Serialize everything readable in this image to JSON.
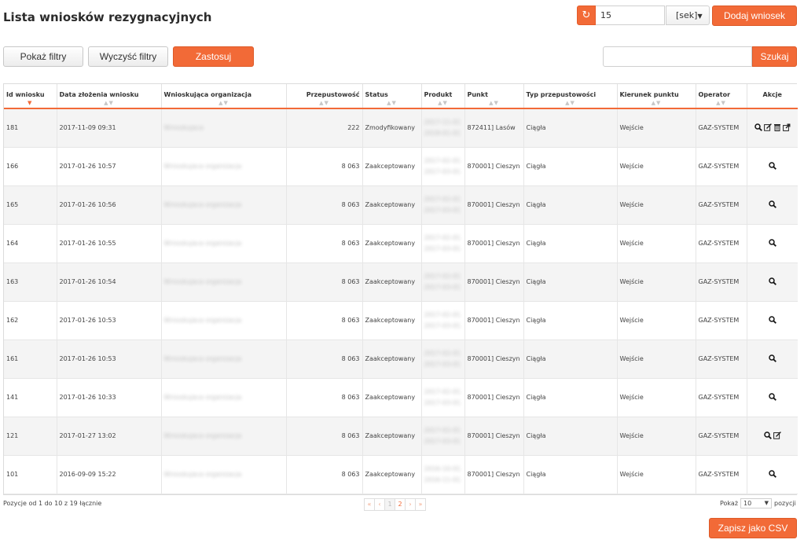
{
  "page": {
    "title": "Lista wniosków rezygnacyjnych"
  },
  "toolbar": {
    "refresh_interval": "15",
    "interval_unit": "[sek]",
    "add_label": "Dodaj wniosek"
  },
  "filters": {
    "show_label": "Pokaż filtry",
    "clear_label": "Wyczyść filtry",
    "apply_label": "Zastosuj",
    "search_value": "",
    "search_label": "Szukaj"
  },
  "table": {
    "columns": [
      "Id wniosku",
      "Data złożenia wniosku",
      "Wnioskująca organizacja",
      "Przepustowość",
      "Status",
      "Produkt",
      "Punkt",
      "Typ przepustowości",
      "Kierunek punktu",
      "Operator",
      "Akcje"
    ],
    "sorted_column": "Id wniosku",
    "sort_direction": "desc",
    "rows": [
      {
        "id": "181",
        "date": "2017-11-09 09:31",
        "org": "Wnioskujaca",
        "capacity": "222",
        "status": "Zmodyfikowany",
        "product_1": "2017-11-01",
        "product_2": "2018-01-01",
        "point": "872411] Lasów",
        "type": "Ciągła",
        "direction": "Wejście",
        "operator": "GAZ-SYSTEM",
        "actions": [
          "search-icon",
          "edit-icon",
          "trash-icon",
          "export-icon"
        ]
      },
      {
        "id": "166",
        "date": "2017-01-26 10:57",
        "org": "Wnioskujaca organizacja",
        "capacity": "8 063",
        "status": "Zaakceptowany",
        "product_1": "2017-02-01",
        "product_2": "2017-03-01",
        "point": "870001] Cieszyn",
        "type": "Ciągła",
        "direction": "Wejście",
        "operator": "GAZ-SYSTEM",
        "actions": [
          "search-icon"
        ]
      },
      {
        "id": "165",
        "date": "2017-01-26 10:56",
        "org": "Wnioskujaca organizacja",
        "capacity": "8 063",
        "status": "Zaakceptowany",
        "product_1": "2017-02-01",
        "product_2": "2017-03-01",
        "point": "870001] Cieszyn",
        "type": "Ciągła",
        "direction": "Wejście",
        "operator": "GAZ-SYSTEM",
        "actions": [
          "search-icon"
        ]
      },
      {
        "id": "164",
        "date": "2017-01-26 10:55",
        "org": "Wnioskujaca organizacja",
        "capacity": "8 063",
        "status": "Zaakceptowany",
        "product_1": "2017-02-01",
        "product_2": "2017-03-01",
        "point": "870001] Cieszyn",
        "type": "Ciągła",
        "direction": "Wejście",
        "operator": "GAZ-SYSTEM",
        "actions": [
          "search-icon"
        ]
      },
      {
        "id": "163",
        "date": "2017-01-26 10:54",
        "org": "Wnioskujaca organizacja",
        "capacity": "8 063",
        "status": "Zaakceptowany",
        "product_1": "2017-02-01",
        "product_2": "2017-03-01",
        "point": "870001] Cieszyn",
        "type": "Ciągła",
        "direction": "Wejście",
        "operator": "GAZ-SYSTEM",
        "actions": [
          "search-icon"
        ]
      },
      {
        "id": "162",
        "date": "2017-01-26 10:53",
        "org": "Wnioskujaca organizacja",
        "capacity": "8 063",
        "status": "Zaakceptowany",
        "product_1": "2017-02-01",
        "product_2": "2017-03-01",
        "point": "870001] Cieszyn",
        "type": "Ciągła",
        "direction": "Wejście",
        "operator": "GAZ-SYSTEM",
        "actions": [
          "search-icon"
        ]
      },
      {
        "id": "161",
        "date": "2017-01-26 10:53",
        "org": "Wnioskujaca organizacja",
        "capacity": "8 063",
        "status": "Zaakceptowany",
        "product_1": "2017-02-01",
        "product_2": "2017-03-01",
        "point": "870001] Cieszyn",
        "type": "Ciągła",
        "direction": "Wejście",
        "operator": "GAZ-SYSTEM",
        "actions": [
          "search-icon"
        ]
      },
      {
        "id": "141",
        "date": "2017-01-26 10:33",
        "org": "Wnioskujaca organizacja",
        "capacity": "8 063",
        "status": "Zaakceptowany",
        "product_1": "2017-02-01",
        "product_2": "2017-03-01",
        "point": "870001] Cieszyn",
        "type": "Ciągła",
        "direction": "Wejście",
        "operator": "GAZ-SYSTEM",
        "actions": [
          "search-icon"
        ]
      },
      {
        "id": "121",
        "date": "2017-01-27 13:02",
        "org": "Wnioskujaca organizacja",
        "capacity": "8 063",
        "status": "Zaakceptowany",
        "product_1": "2017-02-01",
        "product_2": "2017-03-01",
        "point": "870001] Cieszyn",
        "type": "Ciągła",
        "direction": "Wejście",
        "operator": "GAZ-SYSTEM",
        "actions": [
          "search-icon",
          "edit-icon"
        ]
      },
      {
        "id": "101",
        "date": "2016-09-09 15:22",
        "org": "Wnioskujaca organizacja",
        "capacity": "8 063",
        "status": "Zaakceptowany",
        "product_1": "2016-10-01",
        "product_2": "2016-11-01",
        "point": "870001] Cieszyn",
        "type": "Ciągła",
        "direction": "Wejście",
        "operator": "GAZ-SYSTEM",
        "actions": [
          "search-icon"
        ]
      }
    ]
  },
  "footer": {
    "info": "Pozycje od 1 do 10 z 19 łącznie",
    "pages": [
      "«",
      "‹",
      "1",
      "2",
      "›",
      "»"
    ],
    "current_page": "2",
    "show_label": "Pokaż",
    "page_size": "10",
    "items_label": "pozycji",
    "csv_label": "Zapisz jako CSV"
  },
  "colors": {
    "accent": "#f26a37",
    "row_alt": "#f4f4f4"
  }
}
